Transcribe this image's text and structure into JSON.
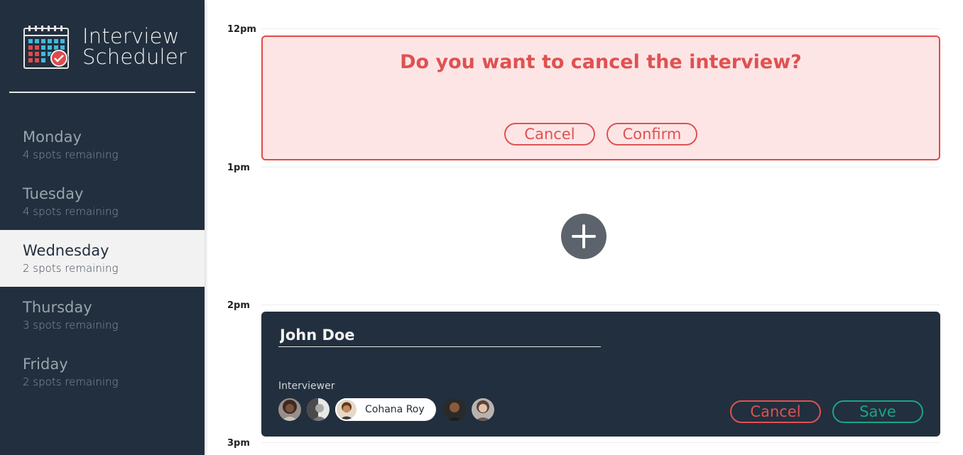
{
  "app": {
    "title_line1": "Interview",
    "title_line2": "Scheduler"
  },
  "days": [
    {
      "name": "Monday",
      "spots": "4 spots remaining",
      "selected": false
    },
    {
      "name": "Tuesday",
      "spots": "4 spots remaining",
      "selected": false
    },
    {
      "name": "Wednesday",
      "spots": "2 spots remaining",
      "selected": true
    },
    {
      "name": "Thursday",
      "spots": "3 spots remaining",
      "selected": false
    },
    {
      "name": "Friday",
      "spots": "2 spots remaining",
      "selected": false
    }
  ],
  "times": [
    "12pm",
    "1pm",
    "2pm",
    "3pm"
  ],
  "confirm": {
    "message": "Do you want to cancel the interview?",
    "cancel_label": "Cancel",
    "confirm_label": "Confirm"
  },
  "form": {
    "student_name": "John Doe",
    "interviewer_label": "Interviewer",
    "selected_interviewer": "Cohana Roy",
    "cancel_label": "Cancel",
    "save_label": "Save"
  },
  "colors": {
    "sidebar": "#222f3e",
    "danger": "#e05151",
    "danger_bg": "#fde5e5",
    "success": "#1aa585",
    "add_button": "#5d636c"
  }
}
